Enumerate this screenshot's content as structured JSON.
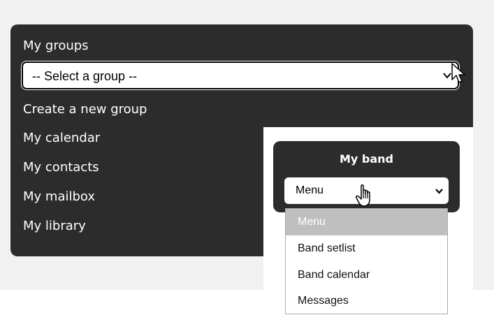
{
  "panel": {
    "title": "My groups",
    "group_select": {
      "value": "-- Select a group --"
    },
    "links": [
      "Create a new group",
      "My calendar",
      "My contacts",
      "My mailbox",
      "My library"
    ]
  },
  "band": {
    "title": "My band",
    "select": {
      "value": "Menu"
    },
    "options": [
      "Menu",
      "Band setlist",
      "Band calendar",
      "Messages"
    ],
    "selected_index": 0
  },
  "icons": {
    "select_chevron": "chevron-down-icon",
    "arrow_cursor": "arrow-cursor-icon",
    "hand_cursor": "hand-pointer-icon"
  },
  "colors": {
    "panel_bg": "#2c2c2c",
    "page_bg": "#f1f1f1",
    "selected_option_bg": "#bfbfbf"
  }
}
